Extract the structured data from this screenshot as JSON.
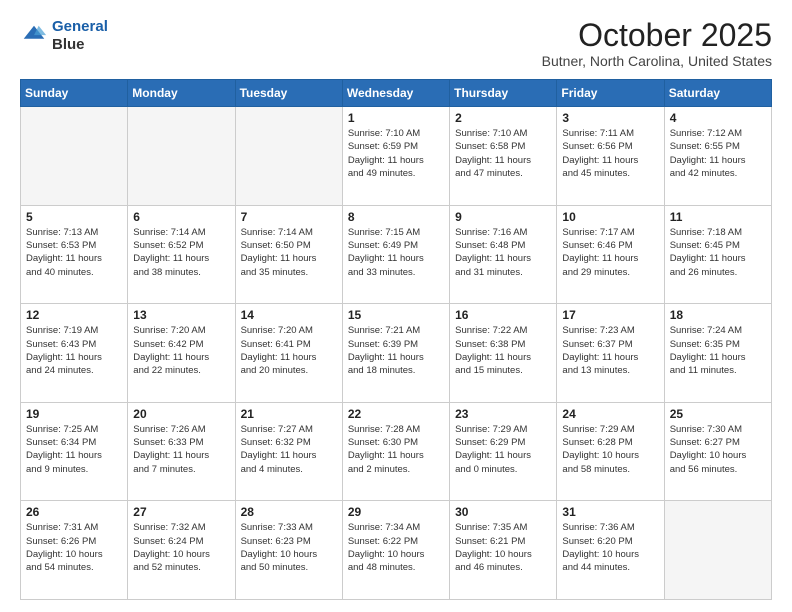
{
  "header": {
    "logo_line1": "General",
    "logo_line2": "Blue",
    "month": "October 2025",
    "location": "Butner, North Carolina, United States"
  },
  "days_of_week": [
    "Sunday",
    "Monday",
    "Tuesday",
    "Wednesday",
    "Thursday",
    "Friday",
    "Saturday"
  ],
  "weeks": [
    [
      {
        "day": "",
        "info": ""
      },
      {
        "day": "",
        "info": ""
      },
      {
        "day": "",
        "info": ""
      },
      {
        "day": "1",
        "info": "Sunrise: 7:10 AM\nSunset: 6:59 PM\nDaylight: 11 hours\nand 49 minutes."
      },
      {
        "day": "2",
        "info": "Sunrise: 7:10 AM\nSunset: 6:58 PM\nDaylight: 11 hours\nand 47 minutes."
      },
      {
        "day": "3",
        "info": "Sunrise: 7:11 AM\nSunset: 6:56 PM\nDaylight: 11 hours\nand 45 minutes."
      },
      {
        "day": "4",
        "info": "Sunrise: 7:12 AM\nSunset: 6:55 PM\nDaylight: 11 hours\nand 42 minutes."
      }
    ],
    [
      {
        "day": "5",
        "info": "Sunrise: 7:13 AM\nSunset: 6:53 PM\nDaylight: 11 hours\nand 40 minutes."
      },
      {
        "day": "6",
        "info": "Sunrise: 7:14 AM\nSunset: 6:52 PM\nDaylight: 11 hours\nand 38 minutes."
      },
      {
        "day": "7",
        "info": "Sunrise: 7:14 AM\nSunset: 6:50 PM\nDaylight: 11 hours\nand 35 minutes."
      },
      {
        "day": "8",
        "info": "Sunrise: 7:15 AM\nSunset: 6:49 PM\nDaylight: 11 hours\nand 33 minutes."
      },
      {
        "day": "9",
        "info": "Sunrise: 7:16 AM\nSunset: 6:48 PM\nDaylight: 11 hours\nand 31 minutes."
      },
      {
        "day": "10",
        "info": "Sunrise: 7:17 AM\nSunset: 6:46 PM\nDaylight: 11 hours\nand 29 minutes."
      },
      {
        "day": "11",
        "info": "Sunrise: 7:18 AM\nSunset: 6:45 PM\nDaylight: 11 hours\nand 26 minutes."
      }
    ],
    [
      {
        "day": "12",
        "info": "Sunrise: 7:19 AM\nSunset: 6:43 PM\nDaylight: 11 hours\nand 24 minutes."
      },
      {
        "day": "13",
        "info": "Sunrise: 7:20 AM\nSunset: 6:42 PM\nDaylight: 11 hours\nand 22 minutes."
      },
      {
        "day": "14",
        "info": "Sunrise: 7:20 AM\nSunset: 6:41 PM\nDaylight: 11 hours\nand 20 minutes."
      },
      {
        "day": "15",
        "info": "Sunrise: 7:21 AM\nSunset: 6:39 PM\nDaylight: 11 hours\nand 18 minutes."
      },
      {
        "day": "16",
        "info": "Sunrise: 7:22 AM\nSunset: 6:38 PM\nDaylight: 11 hours\nand 15 minutes."
      },
      {
        "day": "17",
        "info": "Sunrise: 7:23 AM\nSunset: 6:37 PM\nDaylight: 11 hours\nand 13 minutes."
      },
      {
        "day": "18",
        "info": "Sunrise: 7:24 AM\nSunset: 6:35 PM\nDaylight: 11 hours\nand 11 minutes."
      }
    ],
    [
      {
        "day": "19",
        "info": "Sunrise: 7:25 AM\nSunset: 6:34 PM\nDaylight: 11 hours\nand 9 minutes."
      },
      {
        "day": "20",
        "info": "Sunrise: 7:26 AM\nSunset: 6:33 PM\nDaylight: 11 hours\nand 7 minutes."
      },
      {
        "day": "21",
        "info": "Sunrise: 7:27 AM\nSunset: 6:32 PM\nDaylight: 11 hours\nand 4 minutes."
      },
      {
        "day": "22",
        "info": "Sunrise: 7:28 AM\nSunset: 6:30 PM\nDaylight: 11 hours\nand 2 minutes."
      },
      {
        "day": "23",
        "info": "Sunrise: 7:29 AM\nSunset: 6:29 PM\nDaylight: 11 hours\nand 0 minutes."
      },
      {
        "day": "24",
        "info": "Sunrise: 7:29 AM\nSunset: 6:28 PM\nDaylight: 10 hours\nand 58 minutes."
      },
      {
        "day": "25",
        "info": "Sunrise: 7:30 AM\nSunset: 6:27 PM\nDaylight: 10 hours\nand 56 minutes."
      }
    ],
    [
      {
        "day": "26",
        "info": "Sunrise: 7:31 AM\nSunset: 6:26 PM\nDaylight: 10 hours\nand 54 minutes."
      },
      {
        "day": "27",
        "info": "Sunrise: 7:32 AM\nSunset: 6:24 PM\nDaylight: 10 hours\nand 52 minutes."
      },
      {
        "day": "28",
        "info": "Sunrise: 7:33 AM\nSunset: 6:23 PM\nDaylight: 10 hours\nand 50 minutes."
      },
      {
        "day": "29",
        "info": "Sunrise: 7:34 AM\nSunset: 6:22 PM\nDaylight: 10 hours\nand 48 minutes."
      },
      {
        "day": "30",
        "info": "Sunrise: 7:35 AM\nSunset: 6:21 PM\nDaylight: 10 hours\nand 46 minutes."
      },
      {
        "day": "31",
        "info": "Sunrise: 7:36 AM\nSunset: 6:20 PM\nDaylight: 10 hours\nand 44 minutes."
      },
      {
        "day": "",
        "info": ""
      }
    ]
  ]
}
